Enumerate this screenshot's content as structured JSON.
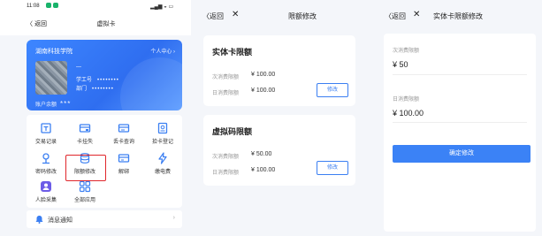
{
  "panel1": {
    "status": {
      "time": "11:08"
    },
    "nav": {
      "back": "〈 返回",
      "title": "虚拟卡"
    },
    "card": {
      "school": "湖南科技学院",
      "center": "个人中心 ›",
      "name_mask": "—",
      "id_label": "学工号",
      "id_value": "••••••••",
      "dept_label": "部门",
      "dept_value": "••••••••",
      "balance_label": "账户余额",
      "balance_value": "***"
    },
    "grid": [
      {
        "label": "交易记录",
        "icon": "receipt-icon"
      },
      {
        "label": "卡挂失",
        "icon": "card-lock-icon"
      },
      {
        "label": "丢卡查询",
        "icon": "card-search-icon"
      },
      {
        "label": "拾卡登记",
        "icon": "card-register-icon"
      },
      {
        "label": "密码修改",
        "icon": "key-icon"
      },
      {
        "label": "限额修改",
        "icon": "database-icon"
      },
      {
        "label": "解绑",
        "icon": "unbind-icon"
      },
      {
        "label": "缴电费",
        "icon": "lightning-icon"
      },
      {
        "label": "人脸采集",
        "icon": "face-icon"
      },
      {
        "label": "全部应用",
        "icon": "apps-icon"
      }
    ],
    "message": {
      "label": "消息通知",
      "chevron": "›"
    }
  },
  "panel2": {
    "nav": {
      "back": "〈返回",
      "close": "✕",
      "title": "限额修改"
    },
    "physical": {
      "title": "实体卡限额",
      "per_label": "次消费限额",
      "per_value": "¥ 100.00",
      "daily_label": "日消费限额",
      "daily_value": "¥ 100.00",
      "edit": "修改"
    },
    "virtual": {
      "title": "虚拟码限额",
      "per_label": "次消费限额",
      "per_value": "¥ 50.00",
      "daily_label": "日消费限额",
      "daily_value": "¥ 100.00",
      "edit": "修改"
    }
  },
  "panel3": {
    "nav": {
      "back": "〈返回",
      "close": "✕",
      "title": "实体卡限额修改"
    },
    "per_label": "次消费限额",
    "per_value": "¥ 50",
    "daily_label": "日消费限额",
    "daily_value": "¥ 100.00",
    "confirm": "确定修改"
  },
  "colors": {
    "accent": "#3b82f6",
    "card": "#2f6ef0",
    "highlight": "#e0262b"
  }
}
